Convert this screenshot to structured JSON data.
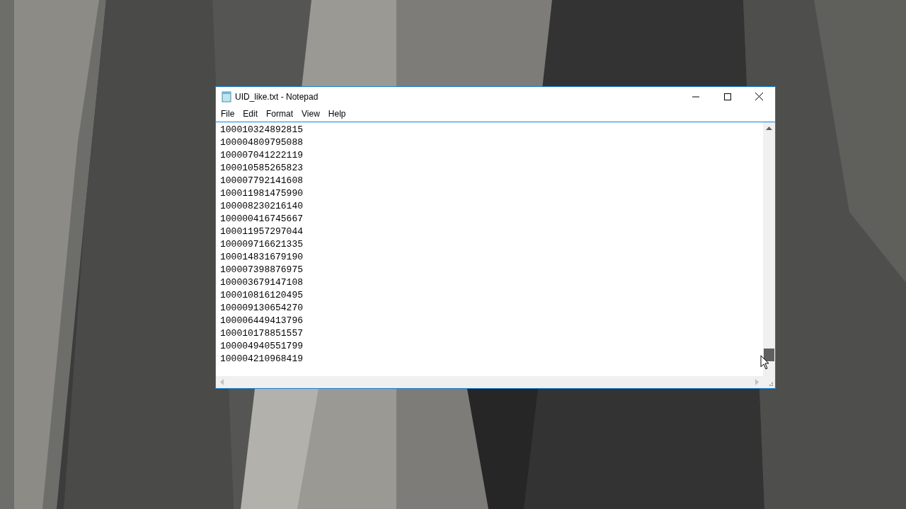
{
  "window": {
    "title": "UID_like.txt - Notepad"
  },
  "menu": [
    "File",
    "Edit",
    "Format",
    "View",
    "Help"
  ],
  "lines": [
    "100010324892815",
    "100004809795088",
    "100007041222119",
    "100010585265823",
    "100007792141608",
    "100011981475990",
    "100008230216140",
    "100000416745667",
    "100011957297044",
    "100009716621335",
    "100014831679190",
    "100007398876975",
    "100003679147108",
    "100010816120495",
    "100009130654270",
    "100006449413796",
    "100010178851557",
    "100004940551799",
    "100004210968419"
  ]
}
